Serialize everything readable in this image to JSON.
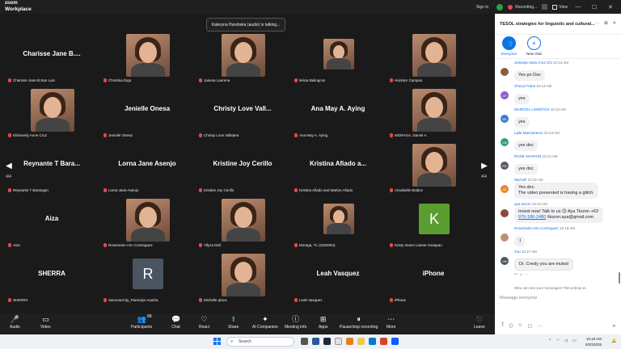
{
  "window": {
    "brand_line1": "zoom",
    "brand_line2": "Workplace",
    "signin": "Sign in",
    "recording": "Recording...",
    "view": "View"
  },
  "talking": "Kateryna Hurebska (audio) is talking...",
  "tiles": [
    {
      "name": "Charisse Jane B....",
      "label": "Charisse Jane B.San Luis",
      "photo": false
    },
    {
      "name": "",
      "label": "Christina Digo",
      "photo": true
    },
    {
      "name": "",
      "label": "Janesa Laurena",
      "photo": true
    },
    {
      "name": "",
      "label": "leticia Balingcos",
      "photo": true
    },
    {
      "name": "",
      "label": "Hazelyn Campos",
      "photo": true
    },
    {
      "name": "",
      "label": "Khimverly Anne Cruz",
      "photo": true
    },
    {
      "name": "Jenielle Onesa",
      "label": "Jenielle Onesa",
      "photo": false
    },
    {
      "name": "Christy Love Vall...",
      "label": "Christy Love Vallejera",
      "photo": false
    },
    {
      "name": "Ana May A. Aying",
      "label": "Ana May A. Aying",
      "photo": false
    },
    {
      "name": "",
      "label": "MORAGA, Daniel A.",
      "photo": true
    },
    {
      "name": "Reynante T Bara...",
      "label": "Reynante T Barangan",
      "photo": false
    },
    {
      "name": "Lorna Jane Asenjo",
      "label": "Lorna Jane Asenjo",
      "photo": false
    },
    {
      "name": "Kristine Joy Cerillo",
      "label": "Kristine Joy Cerillo",
      "photo": false
    },
    {
      "name": "Kristina Afiado a...",
      "label": "Kristina Afiado and Marlon Afiado",
      "photo": false
    },
    {
      "name": "",
      "label": "Annabelle Baldoz",
      "photo": true
    },
    {
      "name": "Aiza",
      "label": "Aiza",
      "photo": false
    },
    {
      "name": "",
      "label": "Rosemarie Ann Cominguez",
      "photo": true
    },
    {
      "name": "",
      "label": "Yllyza Diel",
      "photo": true
    },
    {
      "name": "",
      "label": "Moraga, TL (2202054)",
      "photo": true
    },
    {
      "name": "",
      "label": "Kristy Grace Lianne Casapao",
      "photo": false,
      "avatar": "K",
      "avatar_color": "#5a9e2f"
    },
    {
      "name": "SHERRA",
      "label": "SHERRA",
      "photo": false
    },
    {
      "name": "",
      "label": "SanJoseCity_Paenalyn Austria",
      "photo": false,
      "avatar": "R",
      "avatar_color": "#4a5561"
    },
    {
      "name": "",
      "label": "Michelle plaza",
      "photo": true
    },
    {
      "name": "Leah Vasquez",
      "label": "Leah Vasquez",
      "photo": false
    },
    {
      "name": "iPhone",
      "label": "iPhone",
      "photo": false
    }
  ],
  "pager": {
    "left": "4/4",
    "right": "4/4"
  },
  "toolbar": {
    "audio": "Audio",
    "video": "Video",
    "participants": "Participants",
    "participants_count": "88",
    "chat": "Chat",
    "react": "React",
    "share": "Share",
    "ai": "AI Companion",
    "info": "Meeting info",
    "apps": "Apps",
    "record": "Pause/stop recording",
    "more": "More",
    "leave": "Leave"
  },
  "chat": {
    "title": "TESOL strategies for linguistic and cultural...",
    "tab_everyone": "Everyone",
    "tab_new": "New chat",
    "messages": [
      {
        "who": "Jessalyn Dela Cruz Chi",
        "time": "10:13 AM",
        "text": "Yes po Doc",
        "av": "",
        "color": "#8b5e3c"
      },
      {
        "who": "Cheryl Frane",
        "time": "10:13 AM",
        "text": "yes",
        "av": "CF",
        "color": "#8a5cc9"
      },
      {
        "who": "MARICEL LOMOTOS",
        "time": "10:13 AM",
        "text": "yes",
        "av": "ML",
        "color": "#3a7bd5"
      },
      {
        "who": "Laila Manzaneros",
        "time": "10:13 AM",
        "text": "yes doc",
        "av": "LM",
        "color": "#2fa07a"
      },
      {
        "who": "ROSE SHARON",
        "time": "10:13 AM",
        "text": "yes doc",
        "av": "RS",
        "color": "#555a66"
      },
      {
        "who": "Mychell",
        "time": "10:15 AM",
        "text": "Yes doc.",
        "text2": "The video presented is having a glitch.",
        "av": "M",
        "color": "#e88a2f"
      },
      {
        "who": "aya tiozon",
        "time": "10:15 AM",
        "text": "Invest now! Talk to us 😊 Aya Tiozon +63 ",
        "link": "976-186-2480",
        "text3": " /tiozon.aya@gmail.com",
        "av": "",
        "color": "#8b4a3c"
      },
      {
        "who": "Rosemarie Ann Cominguez",
        "time": "10:16 AM",
        "text": ":)",
        "av": "",
        "color": "#c0907a"
      },
      {
        "who": "You",
        "time": "10:17 AM",
        "text": "Dr. Cresly you are muted",
        "av": "VM",
        "color": "#4a5561"
      }
    ],
    "who_can_see": "Who can see your messages? Recording on",
    "placeholder": "Message everyone"
  },
  "taskbar": {
    "search": "Search",
    "time": "10:18 AM",
    "date": "9/20/2025"
  }
}
